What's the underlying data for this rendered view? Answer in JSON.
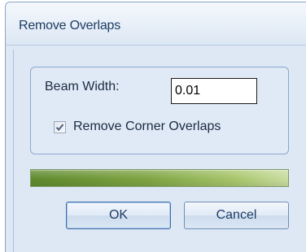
{
  "dialog": {
    "title": "Remove Overlaps"
  },
  "form": {
    "beam_width_label": "Beam Width:",
    "beam_width_value": "0.01",
    "remove_corner_overlaps_label": "Remove Corner Overlaps",
    "remove_corner_overlaps_checked": true
  },
  "progress": {
    "percent": 100,
    "color": "#7ea443"
  },
  "buttons": {
    "ok_label": "OK",
    "cancel_label": "Cancel"
  }
}
